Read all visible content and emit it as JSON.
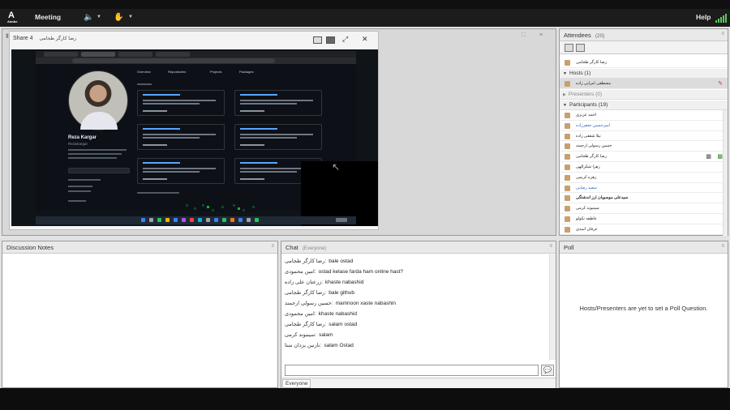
{
  "menubar": {
    "logo_text": "Adobe",
    "meeting": "Meeting",
    "help": "Help"
  },
  "share": {
    "title": "Share 4",
    "presenter": "رضا کارگر طجامی"
  },
  "github": {
    "name": "Reza Kargar",
    "username": "RezaKargar",
    "tabs": [
      "Overview",
      "Repositories",
      "Projects",
      "Packages"
    ],
    "edit_profile": "Edit profile",
    "contributions": "154 contributions in the last year"
  },
  "attendees": {
    "title": "Attendees",
    "count": "(20)",
    "me": "رضا کارگر طجامی",
    "hosts_label": "Hosts (1)",
    "host": "مصطفی امرایی زاده",
    "presenters_label": "Presenters (0)",
    "participants_label": "Participants (19)",
    "participants": [
      "احمد عزیزی",
      "امیرحسین جعفرزاده",
      "نیلا شفقی زاده",
      "حسین رسولی ارجمند",
      "رضا کارگر طجامی",
      "زهرا شکرالهی",
      "زهره کریمی",
      "سعید رضایی",
      "سیدعلی موسویان ارز اندشتگی",
      "سینبوند کرمی",
      "عاطفه نکولو",
      "عرفان اسدی"
    ]
  },
  "notes": {
    "title": "Discussion Notes"
  },
  "chat": {
    "title": "Chat",
    "scope": "(Everyone)",
    "tab": "Everyone",
    "messages": [
      {
        "who": "رضا کارگر طجامی:",
        "text": "bale ostad"
      },
      {
        "who": "امین محمودی:",
        "text": "ostad kelase farda ham online hast?"
      },
      {
        "who": "زرعتان علی زاده:",
        "text": "khaste nabashid"
      },
      {
        "who": "رضا کارگر طجامی:",
        "text": "bale github"
      },
      {
        "who": "حسین رسولی ارجمند:",
        "text": "mamnoon xaste nabashin"
      },
      {
        "who": "امین محمودی:",
        "text": "khaste nabashid"
      },
      {
        "who": "رضا کارگر طجامی:",
        "text": "salam ostad"
      },
      {
        "who": "سینبوند کرمی:",
        "text": "salam"
      },
      {
        "who": "نازنین یزدان ستا:",
        "text": "salam Ostad"
      }
    ]
  },
  "poll": {
    "title": "Poll",
    "message": "Hosts/Presenters are yet to set a Poll Question."
  },
  "colors": {
    "accent": "#2a5fb5",
    "signal": "#5bc95b"
  }
}
